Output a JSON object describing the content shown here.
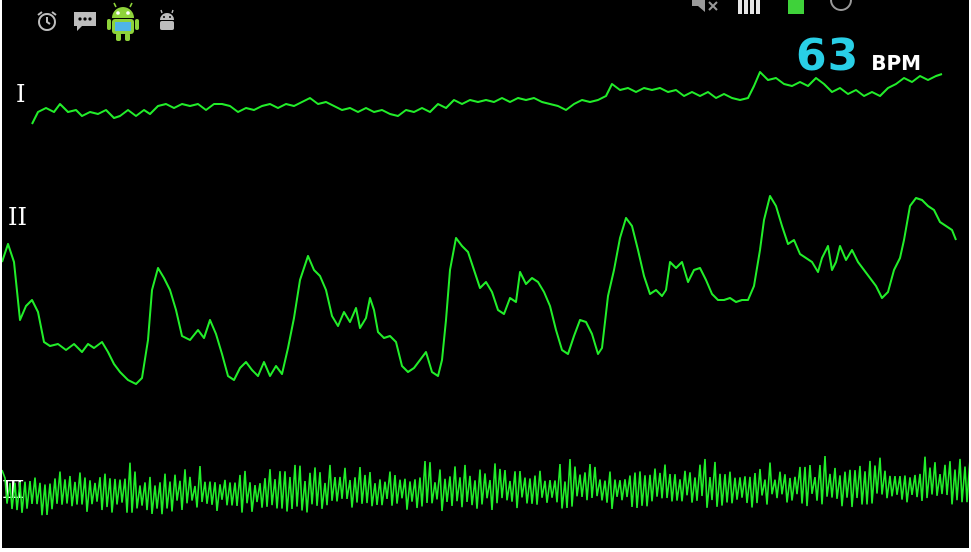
{
  "status_bar": {
    "icons": [
      "alarm-clock-icon",
      "chat-bubble-icon",
      "android-mascot-icon",
      "android-debug-icon",
      "volume-muted-icon",
      "signal-bars-icon",
      "battery-icon",
      "clock-icon"
    ]
  },
  "heart_rate": {
    "value": "63",
    "unit": "BPM"
  },
  "leads": {
    "i": {
      "label": "I"
    },
    "ii": {
      "label": "II"
    },
    "iii": {
      "label": "III"
    }
  },
  "colors": {
    "background": "#000000",
    "trace": "#22ee2a",
    "bpm_value": "#29cfe6",
    "bpm_unit": "#ffffff",
    "labels": "#ffffff"
  }
}
